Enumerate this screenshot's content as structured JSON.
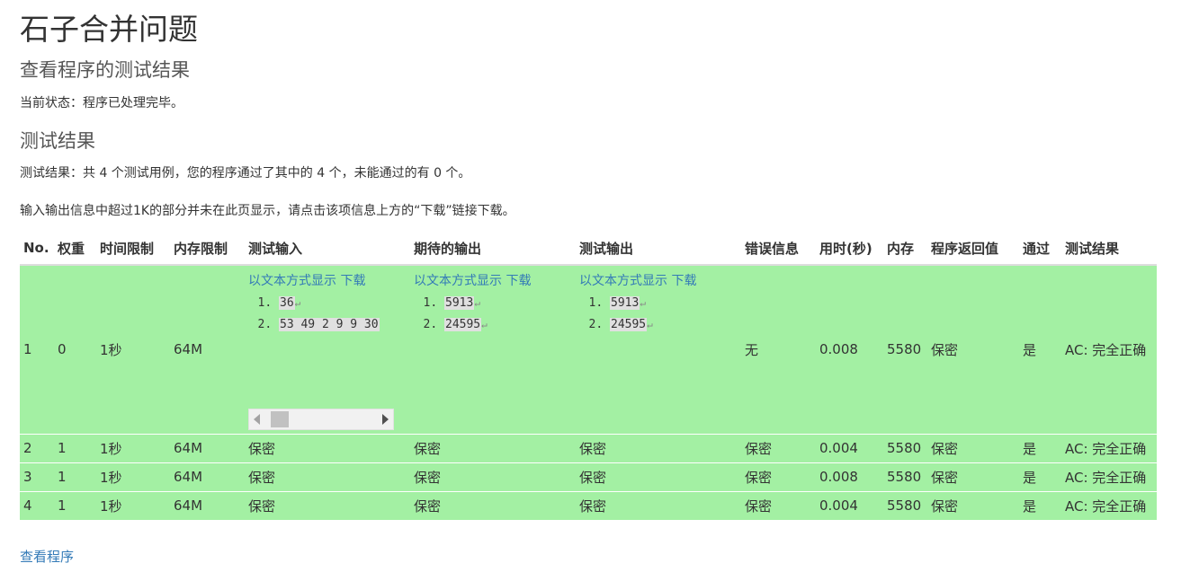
{
  "title": "石子合并问题",
  "subtitle": "查看程序的测试结果",
  "status": "当前状态：程序已处理完毕。",
  "results_heading": "测试结果",
  "summary": "测试结果：共 4 个测试用例，您的程序通过了其中的 4 个，未能通过的有 0 个。",
  "note": "输入输出信息中超过1K的部分并未在此页显示，请点击该项信息上方的“下载”链接下载。",
  "table": {
    "headers": [
      "No.",
      "权重",
      "时间限制",
      "内存限制",
      "测试输入",
      "期待的输出",
      "测试输出",
      "错误信息",
      "用时(秒)",
      "内存",
      "程序返回值",
      "通过",
      "测试结果"
    ],
    "io_links": {
      "show_text": "以文本方式显示",
      "download": "下载"
    },
    "rows": [
      {
        "no": "1",
        "weight": "0",
        "time_limit": "1秒",
        "mem_limit": "64M",
        "input_lines": [
          "36",
          "53 49 2 9 9 30"
        ],
        "expected_lines": [
          "5913",
          "24595"
        ],
        "output_lines": [
          "5913",
          "24595"
        ],
        "error": "无",
        "time": "0.008",
        "memory": "5580",
        "return": "保密",
        "passed": "是",
        "result": "AC: 完全正确"
      },
      {
        "no": "2",
        "weight": "1",
        "time_limit": "1秒",
        "mem_limit": "64M",
        "input": "保密",
        "expected": "保密",
        "output": "保密",
        "error": "保密",
        "time": "0.004",
        "memory": "5580",
        "return": "保密",
        "passed": "是",
        "result": "AC: 完全正确"
      },
      {
        "no": "3",
        "weight": "1",
        "time_limit": "1秒",
        "mem_limit": "64M",
        "input": "保密",
        "expected": "保密",
        "output": "保密",
        "error": "保密",
        "time": "0.008",
        "memory": "5580",
        "return": "保密",
        "passed": "是",
        "result": "AC: 完全正确"
      },
      {
        "no": "4",
        "weight": "1",
        "time_limit": "1秒",
        "mem_limit": "64M",
        "input": "保密",
        "expected": "保密",
        "output": "保密",
        "error": "保密",
        "time": "0.004",
        "memory": "5580",
        "return": "保密",
        "passed": "是",
        "result": "AC: 完全正确"
      }
    ]
  },
  "footer_link": "查看程序",
  "colors": {
    "row_bg": "#a3f0a3",
    "link": "#337ab7"
  },
  "icons": [
    "scroll-left-arrow-icon",
    "scroll-right-arrow-icon",
    "return-char-icon"
  ]
}
